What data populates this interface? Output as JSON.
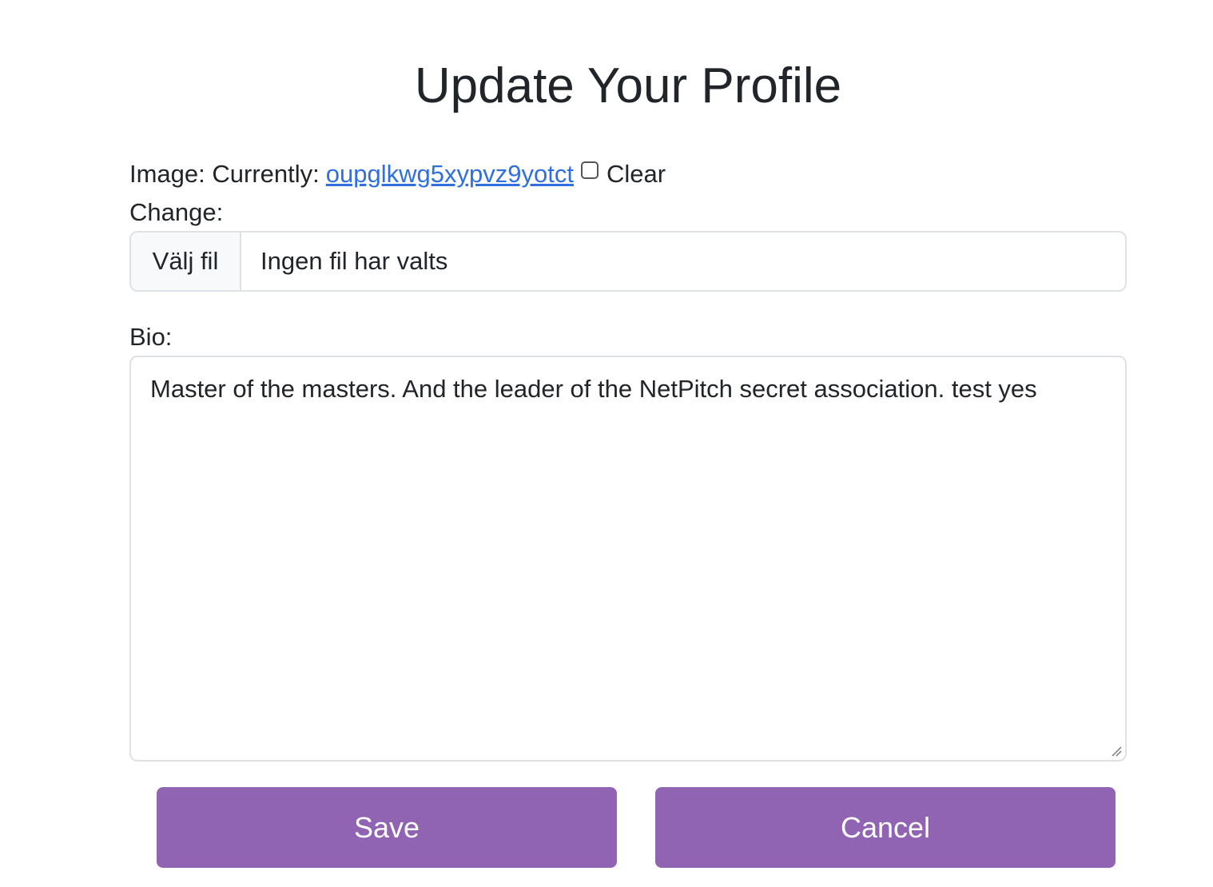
{
  "page": {
    "title": "Update Your Profile"
  },
  "image_field": {
    "label": "Image: Currently:",
    "current_file": "oupglkwg5xypvz9yotct",
    "clear_label": "Clear",
    "clear_checked": false,
    "change_label": "Change:"
  },
  "file_input": {
    "button_label": "Välj fil",
    "status_text": "Ingen fil har valts"
  },
  "bio": {
    "label": "Bio:",
    "value": "Master of the masters. And the leader of the NetPitch secret association. test yes"
  },
  "actions": {
    "save_label": "Save",
    "cancel_label": "Cancel"
  },
  "colors": {
    "button_bg": "#9163b3",
    "link": "#2f6fe0",
    "text": "#212529",
    "border": "#dee2e6"
  }
}
